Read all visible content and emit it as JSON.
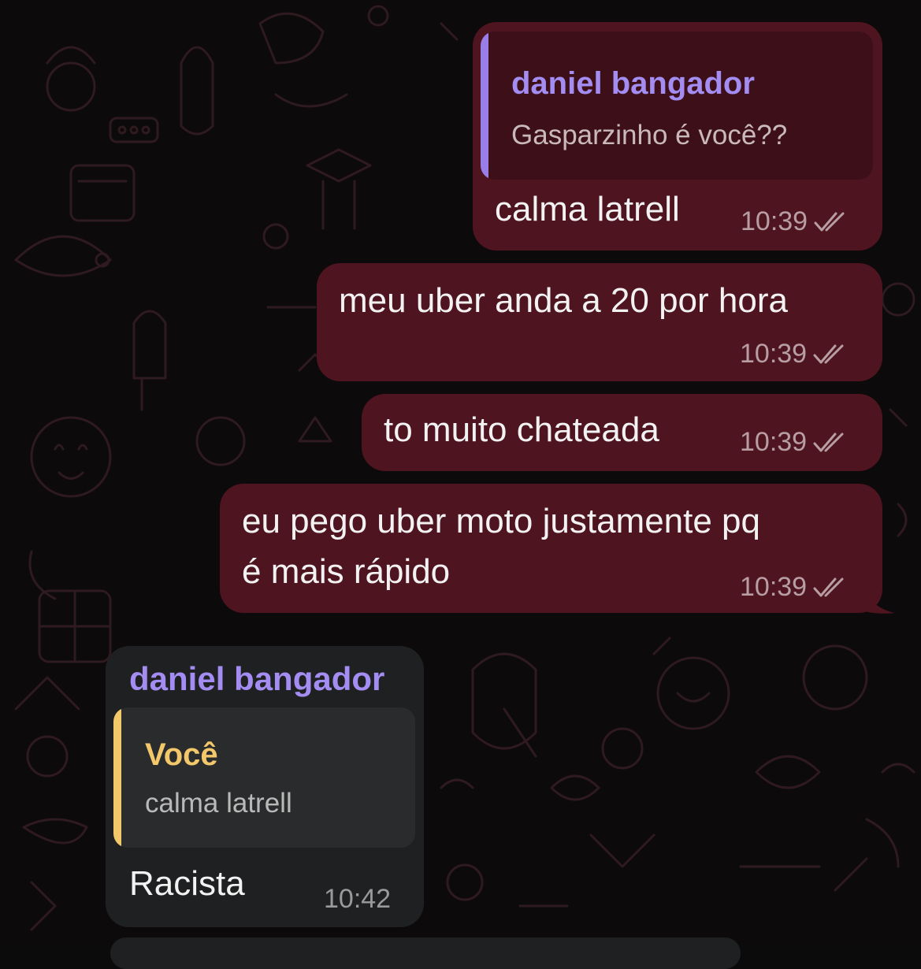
{
  "colors": {
    "outgoing_bubble": "#4e1420",
    "incoming_bubble": "#1f2021",
    "sender_purple": "#a38df2",
    "reply_purple": "#9a7ee8",
    "reply_yellow": "#f3c86b"
  },
  "messages": [
    {
      "direction": "outgoing",
      "reply": {
        "name": "daniel bangador",
        "text": "Gasparzinho é você??"
      },
      "text": "calma latrell",
      "time": "10:39",
      "status_icon": "double-check-icon"
    },
    {
      "direction": "outgoing",
      "text": "meu uber anda a 20 por hora",
      "time": "10:39",
      "status_icon": "double-check-icon"
    },
    {
      "direction": "outgoing",
      "text": "to muito chateada",
      "time": "10:39",
      "status_icon": "double-check-icon"
    },
    {
      "direction": "outgoing",
      "text_lines": [
        "eu pego uber moto justamente pq",
        "é mais rápido"
      ],
      "time": "10:39",
      "status_icon": "double-check-icon"
    },
    {
      "direction": "incoming",
      "sender": "daniel bangador",
      "reply": {
        "name": "Você",
        "text": "calma latrell"
      },
      "text": "Racista",
      "time": "10:42"
    }
  ]
}
